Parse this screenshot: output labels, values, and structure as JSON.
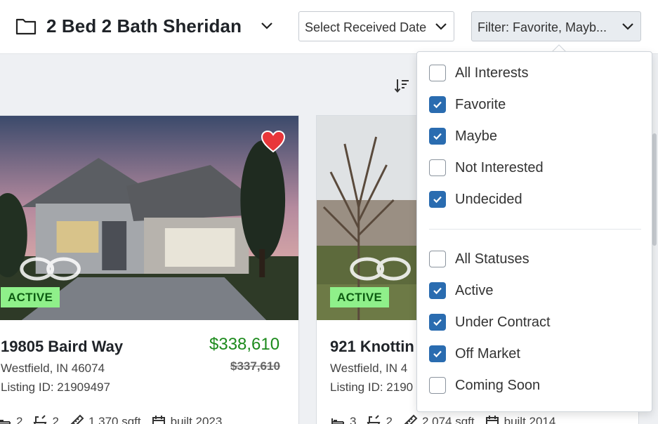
{
  "header": {
    "title": "2 Bed 2 Bath Sheridan",
    "date_select_label": "Select Received Date",
    "filter_label": "Filter: Favorite, Mayb..."
  },
  "icons": {
    "folder": "folder-icon",
    "chevron": "chevron-down-icon",
    "sort": "sort-descending-icon",
    "heart": "heart-icon",
    "bed": "bed-icon",
    "bath": "bath-icon",
    "ruler": "ruler-icon",
    "calendar": "calendar-icon",
    "check": "check-icon"
  },
  "colors": {
    "accent": "#2a6cb0",
    "price": "#1c8a1c",
    "badge_bg": "#8ff08a",
    "heart": "#e8363a"
  },
  "listings": [
    {
      "status": "ACTIVE",
      "address": "19805 Baird Way",
      "price": "$338,610",
      "old_price": "$337,610",
      "city": "Westfield, IN 46074",
      "listing_id": "Listing ID: 21909497",
      "beds": "2",
      "baths": "2",
      "sqft": "1,370 sqft",
      "built": "built 2023",
      "favorite": true
    },
    {
      "status": "ACTIVE",
      "address": "921 Knottin",
      "city": "Westfield, IN 4",
      "listing_id": "Listing ID: 2190",
      "beds": "3",
      "baths": "2",
      "sqft": "2,074 sqft",
      "built": "built 2014",
      "favorite": false
    }
  ],
  "filter_dropdown": {
    "interests": [
      {
        "label": "All Interests",
        "checked": false
      },
      {
        "label": "Favorite",
        "checked": true
      },
      {
        "label": "Maybe",
        "checked": true
      },
      {
        "label": "Not Interested",
        "checked": false
      },
      {
        "label": "Undecided",
        "checked": true
      }
    ],
    "statuses": [
      {
        "label": "All Statuses",
        "checked": false
      },
      {
        "label": "Active",
        "checked": true
      },
      {
        "label": "Under Contract",
        "checked": true
      },
      {
        "label": "Off Market",
        "checked": true
      },
      {
        "label": "Coming Soon",
        "checked": false
      }
    ]
  }
}
